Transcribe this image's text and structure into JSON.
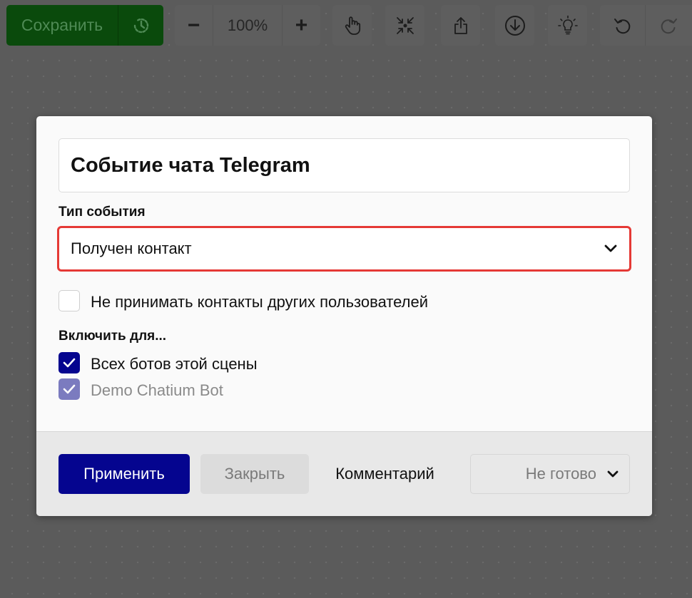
{
  "toolbar": {
    "save_label": "Сохранить",
    "zoom_value": "100%",
    "zoom_out_symbol": "−",
    "zoom_in_symbol": "+",
    "icons": [
      "history-icon",
      "hand-icon",
      "collapse-icon",
      "share-icon",
      "download-icon",
      "lightbulb-icon",
      "undo-icon",
      "redo-icon"
    ]
  },
  "dialog": {
    "title": "Событие чата Telegram",
    "event_type_label": "Тип события",
    "event_type_value": "Получен контакт",
    "ignore_others_label": "Не принимать контакты других пользователей",
    "ignore_others_checked": false,
    "enable_for_label": "Включить для...",
    "enable_options": [
      {
        "label": "Всех ботов этой сцены",
        "checked": true,
        "disabled": false
      },
      {
        "label": "Demo Chatium Bot",
        "checked": true,
        "disabled": true
      }
    ],
    "apply_label": "Применить",
    "close_label": "Закрыть",
    "comment_label": "Комментарий",
    "status_value": "Не готово"
  },
  "colors": {
    "accent": "#05058f",
    "highlight_border": "#e53935",
    "save_bg": "#0a4a0c"
  }
}
